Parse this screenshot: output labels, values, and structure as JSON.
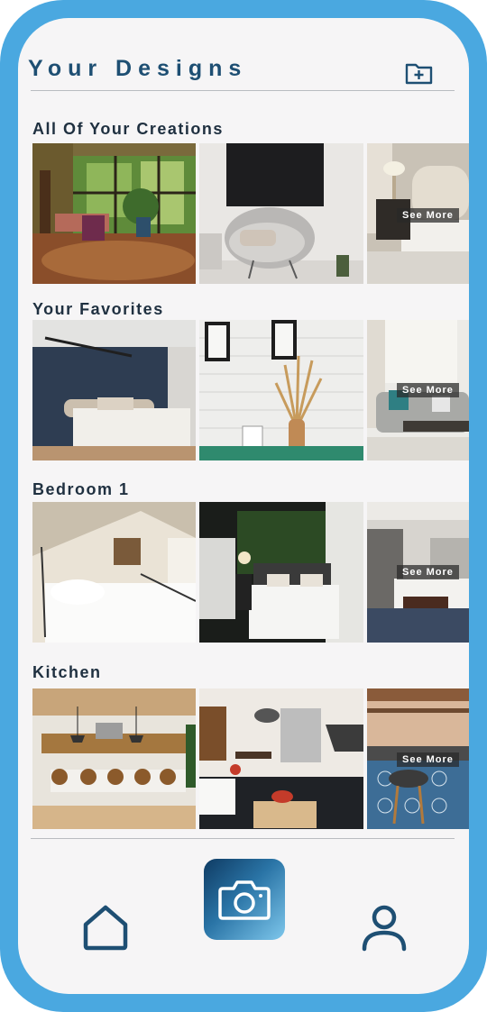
{
  "header": {
    "title": "Your Designs"
  },
  "sections": [
    {
      "title": "All Of Your Creations",
      "see_more": "See More"
    },
    {
      "title": "Your Favorites",
      "see_more": "See More"
    },
    {
      "title": "Bedroom 1",
      "see_more": "See More"
    },
    {
      "title": "Kitchen",
      "see_more": "See More"
    }
  ],
  "nav": {
    "home_icon": "home-icon",
    "camera_icon": "camera-icon",
    "profile_icon": "profile-icon"
  },
  "colors": {
    "frame": "#4aa8e0",
    "title": "#1e4f73",
    "background": "#f6f5f6"
  }
}
